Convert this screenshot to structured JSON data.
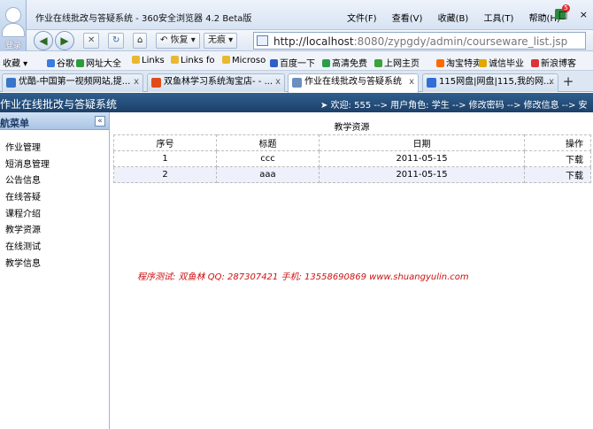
{
  "window": {
    "title": "作业在线批改与答疑系统 - 360安全浏览器 4.2 Beta版",
    "avatar_label": "登录",
    "menu": [
      "文件(F)",
      "查看(V)",
      "收藏(B)",
      "工具(T)",
      "帮助(H)"
    ],
    "notif_count": "5",
    "min_glyph": "–",
    "max_glyph": "□",
    "close_glyph": "×"
  },
  "toolbar": {
    "back_glyph": "◀",
    "forward_glyph": "▶",
    "stop_glyph": "✕",
    "refresh_glyph": "↻",
    "home_glyph": "⌂",
    "restore_label": "↶ 恢复 ▾",
    "trace_label": "无痕 ▾",
    "url_host": "http://localhost",
    "url_rest": ":8080/zypgdy/admin/courseware_list.jsp"
  },
  "bookmarks": [
    {
      "label": "收藏 ▾",
      "color": "#f0f4fa"
    },
    {
      "label": "谷歌",
      "color": "#3c7be0"
    },
    {
      "label": "网址大全",
      "color": "#2c9c3a"
    },
    {
      "label": "Links",
      "color": "#e8b830"
    },
    {
      "label": "Links fo",
      "color": "#e8b830"
    },
    {
      "label": "Microso",
      "color": "#e8b830"
    },
    {
      "label": "百度一下",
      "color": "#2d5fc9"
    },
    {
      "label": "高清免费",
      "color": "#2a9e4c"
    },
    {
      "label": "上网主页",
      "color": "#3aa33a"
    },
    {
      "label": "淘宝特卖",
      "color": "#ff6a00"
    },
    {
      "label": "诚信毕业",
      "color": "#e0a800"
    },
    {
      "label": "新浪博客",
      "color": "#d33"
    }
  ],
  "tabs": [
    {
      "label": "优酷-中国第一视频网站,提...",
      "color": "#3a75c9"
    },
    {
      "label": "双鱼林学习系统淘宝店- - ...",
      "color": "#e24a1b"
    },
    {
      "label": "作业在线批改与答疑系统",
      "color": "#6a8fc0"
    },
    {
      "label": "115网盘|网盘|115,我的网...",
      "color": "#2f6fd6"
    }
  ],
  "tab_close": "x",
  "new_tab": "+",
  "app": {
    "title": "作业在线批改与答疑系统",
    "info": "➤ 欢迎: 555 --> 用户角色: 学生 --> 修改密码 --> 修改信息 --> 安"
  },
  "sidebar": {
    "title": "航菜单",
    "collapse_glyph": "«",
    "items": [
      "作业管理",
      "短消息管理",
      "公告信息",
      "在线答疑",
      "课程介绍",
      "教学资源",
      "在线测试",
      "教学信息"
    ]
  },
  "main": {
    "title": "教学资源",
    "table": {
      "headers": [
        "序号",
        "标题",
        "日期",
        "操作"
      ],
      "rows": [
        [
          "1",
          "ccc",
          "2011-05-15",
          "下载"
        ],
        [
          "2",
          "aaa",
          "2011-05-15",
          "下载"
        ]
      ]
    },
    "footer": "程序测试: 双鱼林  QQ: 287307421  手机: 13558690869  www.shuangyulin.com"
  }
}
